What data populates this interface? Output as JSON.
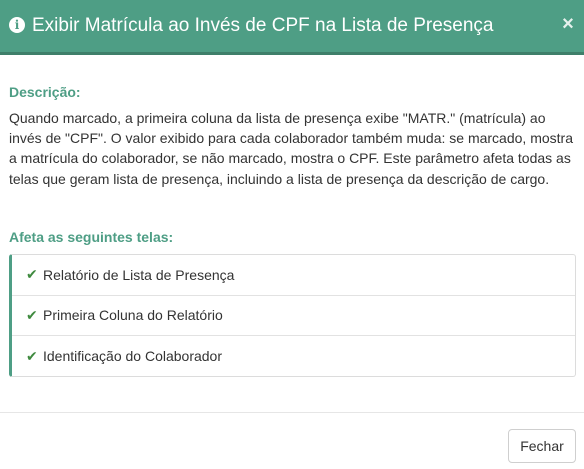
{
  "header": {
    "title": "Exibir Matrícula ao Invés de CPF na Lista de Presença",
    "info_glyph": "i",
    "close_glyph": "×"
  },
  "description": {
    "label": "Descrição:",
    "text": "Quando marcado, a primeira coluna da lista de presença exibe \"MATR.\" (matrícula) ao invés de \"CPF\". O valor exibido para cada colaborador também muda: se marcado, mostra a matrícula do colaborador, se não marcado, mostra o CPF. Este parâmetro afeta todas as telas que geram lista de presença, incluindo a lista de presença da descrição de cargo."
  },
  "affects": {
    "label": "Afeta as seguintes telas:",
    "check_glyph": "✔",
    "items": [
      "Relatório de Lista de Presença",
      "Primeira Coluna do Relatório",
      "Identificação do Colaborador"
    ]
  },
  "footer": {
    "close_button_label": "Fechar"
  },
  "colors": {
    "header_bg": "#4e9e85",
    "accent": "#4e9e85",
    "check": "#3f8a3f"
  },
  "icons": {
    "info": "info-circle-icon",
    "close": "close-icon",
    "check": "check-icon"
  }
}
